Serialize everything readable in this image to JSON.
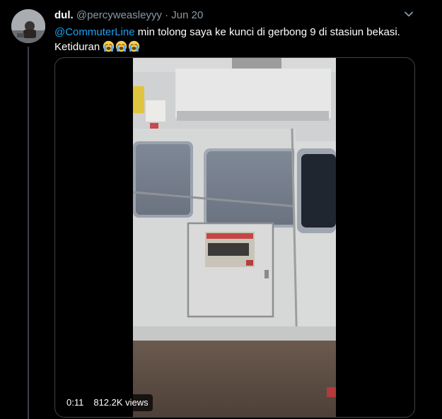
{
  "tweet": {
    "display_name": "dul.",
    "handle": "@percyweasleyyy",
    "separator": "·",
    "date": "Jun 20",
    "mention": "@CommuterLine",
    "text": " min tolong saya ke kunci di gerbong 9 di stasiun bekasi.",
    "text_line2": "Ketiduran",
    "emoji_names": [
      "loudly-crying-face",
      "loudly-crying-face",
      "loudly-crying-face"
    ]
  },
  "video": {
    "duration": "0:11",
    "views": "812.2K views"
  },
  "icons": {
    "menu": "chevron-down-icon",
    "avatar": "avatar"
  },
  "colors": {
    "background": "#000000",
    "accent": "#1da1f2",
    "muted": "#8899a6",
    "border": "#3d4148"
  }
}
